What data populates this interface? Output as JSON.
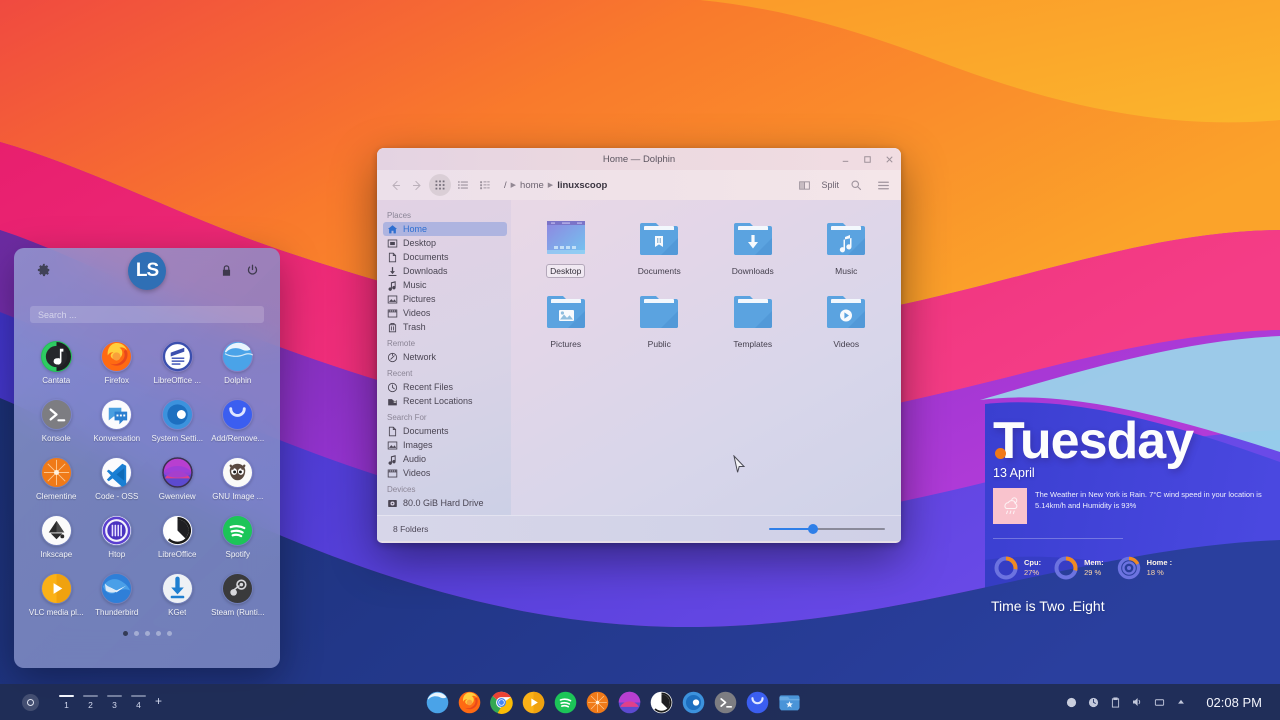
{
  "wallpaper": {
    "colors": [
      "#6b2ba0",
      "#f05a3c",
      "#fa9b28",
      "#f8a32a",
      "#ec2a7c",
      "#8c3ad0",
      "#4a3ad8",
      "#1b3075",
      "#9ad7ea"
    ]
  },
  "launcher": {
    "logo_text": "LS",
    "settings_icon": "gear-icon",
    "lock_icon": "lock-icon",
    "power_icon": "power-icon",
    "search_placeholder": "Search ...",
    "apps": [
      {
        "name": "Cantata",
        "icon": "cantata-icon"
      },
      {
        "name": "Firefox",
        "icon": "firefox-icon"
      },
      {
        "name": "LibreOffice ...",
        "icon": "libreoffice-writer-icon"
      },
      {
        "name": "Dolphin",
        "icon": "dolphin-icon"
      },
      {
        "name": "Konsole",
        "icon": "konsole-icon"
      },
      {
        "name": "Konversation",
        "icon": "konversation-icon"
      },
      {
        "name": "System Setti...",
        "icon": "system-settings-icon"
      },
      {
        "name": "Add/Remove...",
        "icon": "discover-icon"
      },
      {
        "name": "Clementine",
        "icon": "clementine-icon"
      },
      {
        "name": "Code - OSS",
        "icon": "vscode-icon"
      },
      {
        "name": "Gwenview",
        "icon": "gwenview-icon"
      },
      {
        "name": "GNU Image ...",
        "icon": "gimp-icon"
      },
      {
        "name": "Inkscape",
        "icon": "inkscape-icon"
      },
      {
        "name": "Htop",
        "icon": "htop-icon"
      },
      {
        "name": "LibreOffice",
        "icon": "libreoffice-icon"
      },
      {
        "name": "Spotify",
        "icon": "spotify-icon"
      },
      {
        "name": "VLC media pl...",
        "icon": "vlc-icon"
      },
      {
        "name": "Thunderbird",
        "icon": "thunderbird-icon"
      },
      {
        "name": "KGet",
        "icon": "kget-icon"
      },
      {
        "name": "Steam (Runti...",
        "icon": "steam-icon"
      }
    ],
    "page_count": 5,
    "active_page": 1
  },
  "dolphin": {
    "title": "Home — Dolphin",
    "window_buttons": {
      "minimize": "minimize-icon",
      "maximize": "maximize-icon",
      "close": "close-icon"
    },
    "toolbar": {
      "back": "back-arrow-icon",
      "forward": "forward-arrow-icon",
      "icon_view": "icon-view-icon",
      "list_view": "list-view-icon",
      "details_view": "details-view-icon",
      "split_label": "Split",
      "split_icon": "split-view-icon",
      "search_icon": "search-icon",
      "menu_icon": "hamburger-menu-icon"
    },
    "breadcrumb": {
      "root": "/",
      "segments": [
        "home",
        "linuxscoop"
      ]
    },
    "places": [
      {
        "group": "Places",
        "items": [
          {
            "label": "Home",
            "icon": "home-icon",
            "selected": true
          },
          {
            "label": "Desktop",
            "icon": "desktop-icon",
            "selected": false
          },
          {
            "label": "Documents",
            "icon": "document-icon",
            "selected": false
          },
          {
            "label": "Downloads",
            "icon": "download-icon",
            "selected": false
          },
          {
            "label": "Music",
            "icon": "music-note-icon",
            "selected": false
          },
          {
            "label": "Pictures",
            "icon": "image-icon",
            "selected": false
          },
          {
            "label": "Videos",
            "icon": "video-icon",
            "selected": false
          },
          {
            "label": "Trash",
            "icon": "trash-icon",
            "selected": false
          }
        ]
      },
      {
        "group": "Remote",
        "items": [
          {
            "label": "Network",
            "icon": "network-icon",
            "selected": false
          }
        ]
      },
      {
        "group": "Recent",
        "items": [
          {
            "label": "Recent Files",
            "icon": "clock-icon",
            "selected": false
          },
          {
            "label": "Recent Locations",
            "icon": "recent-locations-icon",
            "selected": false
          }
        ]
      },
      {
        "group": "Search For",
        "items": [
          {
            "label": "Documents",
            "icon": "document-icon",
            "selected": false
          },
          {
            "label": "Images",
            "icon": "image-icon",
            "selected": false
          },
          {
            "label": "Audio",
            "icon": "music-note-icon",
            "selected": false
          },
          {
            "label": "Videos",
            "icon": "video-icon",
            "selected": false
          }
        ]
      },
      {
        "group": "Devices",
        "items": [
          {
            "label": "80.0 GiB Hard Drive",
            "icon": "harddrive-icon",
            "selected": false
          }
        ]
      }
    ],
    "folders": [
      {
        "name": "Desktop",
        "icon": "desktop-preview-icon",
        "selected": true
      },
      {
        "name": "Documents",
        "icon": "folder-documents-icon",
        "selected": false
      },
      {
        "name": "Downloads",
        "icon": "folder-downloads-icon",
        "selected": false
      },
      {
        "name": "Music",
        "icon": "folder-music-icon",
        "selected": false
      },
      {
        "name": "Pictures",
        "icon": "folder-pictures-icon",
        "selected": false
      },
      {
        "name": "Public",
        "icon": "folder-icon",
        "selected": false
      },
      {
        "name": "Templates",
        "icon": "folder-icon",
        "selected": false
      },
      {
        "name": "Videos",
        "icon": "folder-videos-icon",
        "selected": false
      }
    ],
    "status_text": "8 Folders",
    "zoom_value": 38
  },
  "widget": {
    "day": "Tuesday",
    "date": "13 April",
    "weather_icon": "rain-cloud-icon",
    "weather_text": "The Weather in New York is Rain. 7°C wind speed in your location is 5.14km/h and Humidity is 93%",
    "monitors": [
      {
        "label": "Cpu:",
        "value": "27%",
        "percent": 27
      },
      {
        "label": "Mem:",
        "value": "29 %",
        "percent": 29
      },
      {
        "label": "Home :",
        "value": "18 %",
        "percent": 18
      }
    ],
    "time_phrase": "Time is Two .Eight"
  },
  "taskbar": {
    "launcher_icon": "app-launcher-icon",
    "desktops": [
      {
        "number": "1",
        "active": true
      },
      {
        "number": "2",
        "active": false
      },
      {
        "number": "3",
        "active": false
      },
      {
        "number": "4",
        "active": false
      }
    ],
    "add_desktop": "+",
    "apps": [
      {
        "name": "dolphin-icon",
        "running": true
      },
      {
        "name": "firefox-icon",
        "running": false
      },
      {
        "name": "chrome-icon",
        "running": false
      },
      {
        "name": "vlc-icon",
        "running": false
      },
      {
        "name": "spotify-icon",
        "running": false
      },
      {
        "name": "clementine-icon",
        "running": false
      },
      {
        "name": "gwenview-icon",
        "running": false
      },
      {
        "name": "libreoffice-icon",
        "running": false
      },
      {
        "name": "system-settings-icon",
        "running": false
      },
      {
        "name": "konsole-icon",
        "running": false
      },
      {
        "name": "discover-icon",
        "running": false
      },
      {
        "name": "file-archive-icon",
        "running": false
      }
    ],
    "tray": [
      "circle-status-icon",
      "update-icon",
      "clipboard-icon",
      "volume-icon",
      "display-icon",
      "show-hidden-icon"
    ],
    "clock": "02:08 PM"
  }
}
